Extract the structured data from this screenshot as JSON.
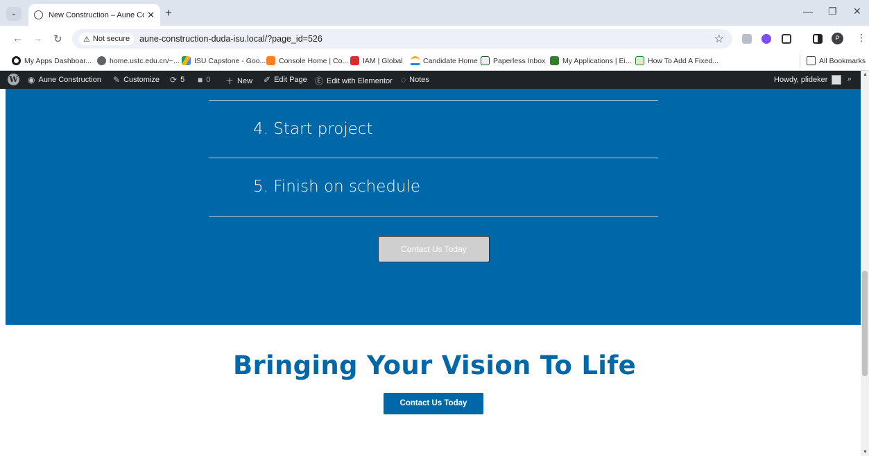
{
  "browser": {
    "tab": {
      "title": "New Construction – Aune Cons"
    },
    "new_tab": "+",
    "address": {
      "security_label": "Not secure",
      "url": "aune-construction-duda-isu.local/?page_id=526"
    },
    "profile_initial": "P",
    "bookmarks": [
      {
        "label": "My Apps Dashboar...",
        "icon_color": "#1a1a1a"
      },
      {
        "label": "home.ustc.edu.cn/~...",
        "icon_color": "#5f6368"
      },
      {
        "label": "ISU Capstone - Goo...",
        "icon_color": "#f4b400"
      },
      {
        "label": "Console Home | Co...",
        "icon_color": "#f58025"
      },
      {
        "label": "IAM | Global",
        "icon_color": "#d32f2f"
      },
      {
        "label": "Candidate Home",
        "icon_color": "#1e88e5"
      },
      {
        "label": "Paperless Inbox",
        "icon_color": "#17541f"
      },
      {
        "label": "My Applications | Ei...",
        "icon_color": "#367c2b"
      },
      {
        "label": "How To Add A Fixed...",
        "icon_color": "#2e7d32"
      }
    ],
    "all_bookmarks": "All Bookmarks"
  },
  "admin_bar": {
    "site_name": "Aune Construction",
    "customize": "Customize",
    "updates_count": "5",
    "comments_count": "0",
    "new": "New",
    "edit_page": "Edit Page",
    "edit_elementor": "Edit with Elementor",
    "notes": "Notes",
    "howdy": "Howdy, plideker"
  },
  "steps": [
    {
      "label": "4. Start project"
    },
    {
      "label": "5. Finish on schedule"
    }
  ],
  "cta_top": {
    "label": "Contact Us Today"
  },
  "bottom": {
    "headline": "Bringing Your Vision To Life",
    "cta_label": "Contact Us Today"
  },
  "colors": {
    "brand_blue": "#0068a8",
    "admin_bar": "#1d2327",
    "chrome_tabbar": "#dee4ee"
  }
}
